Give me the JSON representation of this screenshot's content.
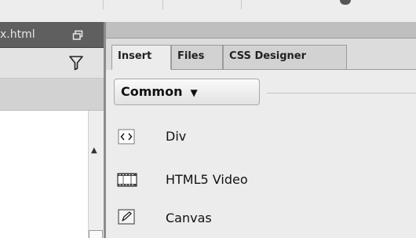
{
  "document_tab": {
    "label": "x.html"
  },
  "insert_panel": {
    "tabs": [
      {
        "label": "Insert",
        "active": true
      },
      {
        "label": "Files",
        "active": false
      },
      {
        "label": "CSS Designer",
        "active": false
      }
    ],
    "category": {
      "label": "Common",
      "caret": "▼"
    },
    "items": [
      {
        "label": "Div",
        "icon": "div-tag-icon"
      },
      {
        "label": "HTML5 Video",
        "icon": "film-strip-icon"
      },
      {
        "label": "Canvas",
        "icon": "canvas-pen-icon"
      }
    ]
  },
  "icons": {
    "restore": "restore-window-icon",
    "filter": "filter-funnel-icon",
    "scroll_up": "scroll-up-arrow-icon"
  }
}
